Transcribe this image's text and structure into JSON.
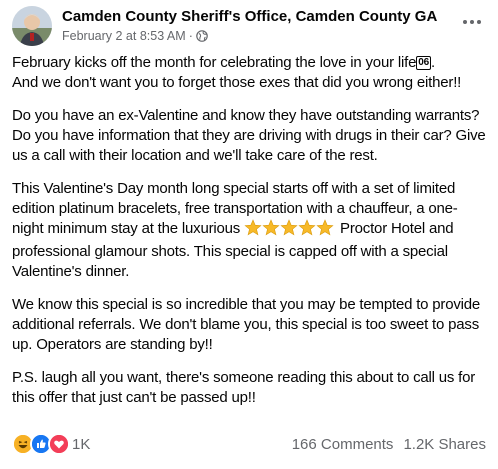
{
  "header": {
    "page_name": "Camden County Sheriff's Office, Camden County GA",
    "timestamp": "February 2 at 8:53 AM",
    "separator": "·",
    "privacy_icon": "globe-icon",
    "more_icon": "more-horizontal-icon"
  },
  "post": {
    "paragraph_1_a": "February kicks off the month for celebrating the love in your life",
    "badge_06": "06",
    "paragraph_1_b": "And we don't want you to forget those exes that did you wrong either!!",
    "paragraph_2": "Do you have an ex-Valentine and know they have outstanding warrants?  Do you have information that they are driving with drugs in their car?  Give us a call with their location and we'll take care of the rest.",
    "paragraph_3_a": "This Valentine's Day month long special starts off with a set of limited edition platinum bracelets, free transportation with a chauffeur, a one-night minimum stay at the luxurious",
    "paragraph_3_b": "Proctor Hotel and professional glamour shots.  This special is capped off with a special Valentine's dinner.",
    "paragraph_4": "We know this special is so incredible that you may be tempted to provide additional referrals.  We don't blame you, this special is too sweet to pass up. Operators are standing by!!",
    "paragraph_5": "P.S. laugh all you want, there's someone reading this about to call us for this offer that just can't be passed up!!"
  },
  "footer": {
    "reaction_count": "1K",
    "comments": "166 Comments",
    "shares": "1.2K Shares",
    "reaction_icons": [
      "haha-icon",
      "like-icon",
      "love-icon"
    ]
  },
  "colors": {
    "text": "#050505",
    "secondary": "#65676b",
    "like_blue": "#1877f2",
    "love_red": "#f33e58",
    "haha_yellow": "#f7b125",
    "star_yellow": "#f7b928"
  }
}
